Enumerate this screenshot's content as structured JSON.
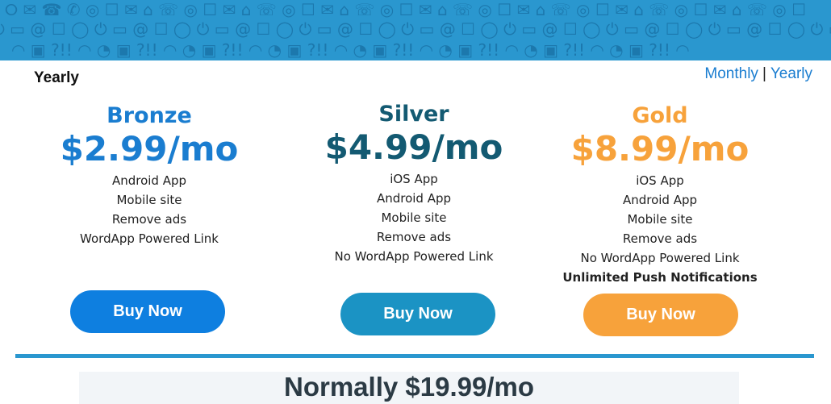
{
  "colors": {
    "banner": "#2a97cf",
    "bronze": "#1a7dd0",
    "silver": "#135a72",
    "gold": "#f7a23b",
    "bronze_button": "#0e7fe0",
    "silver_button": "#1b93c4",
    "gold_button": "#f7a23b",
    "link": "#1a7dd0"
  },
  "banner_icons": [
    "rss-icon",
    "twitter-icon",
    "camera-icon",
    "monitor-icon",
    "email-icon",
    "chat-icon",
    "phone-icon"
  ],
  "billing": {
    "heading": "Yearly",
    "monthly_label": "Monthly",
    "separator": "|",
    "yearly_label": "Yearly"
  },
  "plans": [
    {
      "name": "Bronze",
      "price": "$2.99/mo",
      "features": [
        "Android App",
        "Mobile site",
        "Remove ads",
        "WordApp Powered Link"
      ],
      "button": "Buy Now"
    },
    {
      "name": "Silver",
      "price": "$4.99/mo",
      "features": [
        "iOS App",
        "Android App",
        "Mobile site",
        "Remove ads",
        "No WordApp Powered Link"
      ],
      "button": "Buy Now"
    },
    {
      "name": "Gold",
      "price": "$8.99/mo",
      "features": [
        "iOS App",
        "Android App",
        "Mobile site",
        "Remove ads",
        "No WordApp Powered Link"
      ],
      "bold_feature": "Unlimited Push Notifications",
      "button": "Buy Now"
    }
  ],
  "normally": "Normally  $19.99/mo"
}
